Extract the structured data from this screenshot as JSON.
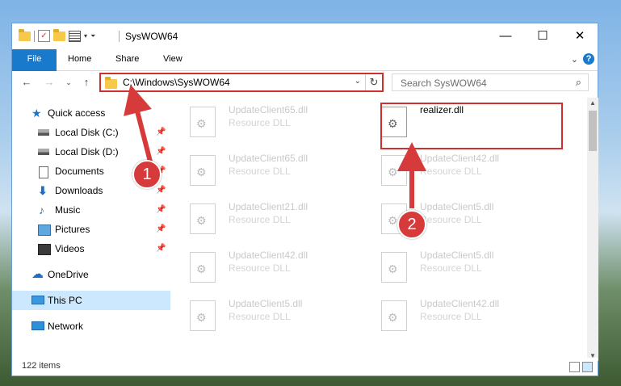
{
  "window": {
    "title": "SysWOW64",
    "minimize": "—",
    "maximize": "☐",
    "close": "✕"
  },
  "ribbon": {
    "tabs": [
      "File",
      "Home",
      "Share",
      "View"
    ],
    "collapse_chevron": "⌄",
    "help": "?"
  },
  "navigation": {
    "back": "←",
    "forward": "→",
    "recent": "⌄",
    "up": "↑",
    "address_path": "C:\\Windows\\SysWOW64",
    "address_dropdown": "⌄",
    "refresh": "↻",
    "search_placeholder": "Search SysWOW64",
    "search_icon": "⌕"
  },
  "nav_pane": {
    "items": [
      {
        "label": "Quick access",
        "icon": "star-icon",
        "pinned": false
      },
      {
        "label": "Local Disk (C:)",
        "icon": "disk-icon",
        "pinned": true
      },
      {
        "label": "Local Disk (D:)",
        "icon": "disk-icon",
        "pinned": true
      },
      {
        "label": "Documents",
        "icon": "documents-icon",
        "pinned": true
      },
      {
        "label": "Downloads",
        "icon": "downloads-icon",
        "pinned": true
      },
      {
        "label": "Music",
        "icon": "music-icon",
        "pinned": true
      },
      {
        "label": "Pictures",
        "icon": "pictures-icon",
        "pinned": true
      },
      {
        "label": "Videos",
        "icon": "videos-icon",
        "pinned": true
      },
      {
        "label": "OneDrive",
        "icon": "cloud-icon",
        "pinned": false
      },
      {
        "label": "This PC",
        "icon": "pc-icon",
        "pinned": false,
        "selected": true
      },
      {
        "label": "Network",
        "icon": "network-icon",
        "pinned": false
      }
    ],
    "pin_glyph": "📌"
  },
  "files": [
    {
      "name": "UpdateClient65.dll",
      "type": "Resource DLL"
    },
    {
      "name": "realizer.dll",
      "type": "",
      "highlighted": true
    },
    {
      "name": "UpdateClient65.dll",
      "type": "Resource DLL"
    },
    {
      "name": "UpdateClient42.dll",
      "type": "Resource DLL"
    },
    {
      "name": "UpdateClient21.dll",
      "type": "Resource DLL"
    },
    {
      "name": "UpdateClient5.dll",
      "type": "Resource DLL"
    },
    {
      "name": "UpdateClient42.dll",
      "type": "Resource DLL"
    },
    {
      "name": "UpdateClient5.dll",
      "type": "Resource DLL"
    },
    {
      "name": "UpdateClient5.dll",
      "type": "Resource DLL"
    },
    {
      "name": "UpdateClient42.dll",
      "type": "Resource DLL"
    }
  ],
  "status": {
    "item_count": "122 items"
  },
  "annotations": {
    "step1": "1",
    "step2": "2",
    "color": "#d12e2e"
  }
}
